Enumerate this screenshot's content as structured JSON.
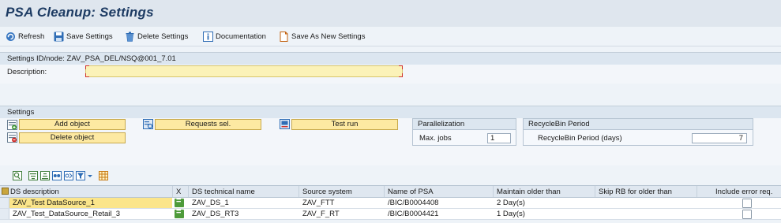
{
  "page": {
    "title": "PSA Cleanup: Settings"
  },
  "toolbar": {
    "refresh": "Refresh",
    "save_settings": "Save Settings",
    "delete_settings": "Delete Settings",
    "documentation": "Documentation",
    "save_as_new": "Save As New Settings"
  },
  "settings_id": {
    "header": "Settings ID/node: ZAV_PSA_DEL/NSQ@001_7.01",
    "description_label": "Description:",
    "description_value": ""
  },
  "settings": {
    "header": "Settings",
    "add_object": "Add object",
    "delete_object": "Delete object",
    "requests_sel": "Requests sel.",
    "test_run": "Test run",
    "parallelization": {
      "header": "Parallelization",
      "max_jobs_label": "Max. jobs",
      "max_jobs_value": "1"
    },
    "recyclebin": {
      "header": "RecycleBin Period",
      "period_label": "RecycleBin Period (days)",
      "period_value": "7"
    }
  },
  "grid": {
    "columns": {
      "ds_description": "DS description",
      "x": "X",
      "ds_technical_name": "DS technical name",
      "source_system": "Source system",
      "name_of_psa": "Name of PSA",
      "maintain_older_than": "Maintain older than",
      "skip_rb": "Skip RB for older than",
      "include_error": "Include error req."
    },
    "rows": [
      {
        "ds_description": "ZAV_Test DataSource_1",
        "ds_technical_name": "ZAV_DS_1",
        "source_system": "ZAV_FTT",
        "name_of_psa": "/BIC/B0004408",
        "maintain_older_than": "2 Day(s)",
        "skip_rb": "",
        "include_error": false
      },
      {
        "ds_description": "ZAV_Test_DataSource_Retail_3",
        "ds_technical_name": "ZAV_DS_RT3",
        "source_system": "ZAV_F_RT",
        "name_of_psa": "/BIC/B0004421",
        "maintain_older_than": "1 Day(s)",
        "skip_rb": "",
        "include_error": false
      }
    ]
  },
  "colors": {
    "title": "#1d3b63",
    "button_yellow": "#fde9a2",
    "selected_row": "#fbe58a",
    "required_input": "#fbf2b8",
    "status_green": "#4e9b3a"
  }
}
